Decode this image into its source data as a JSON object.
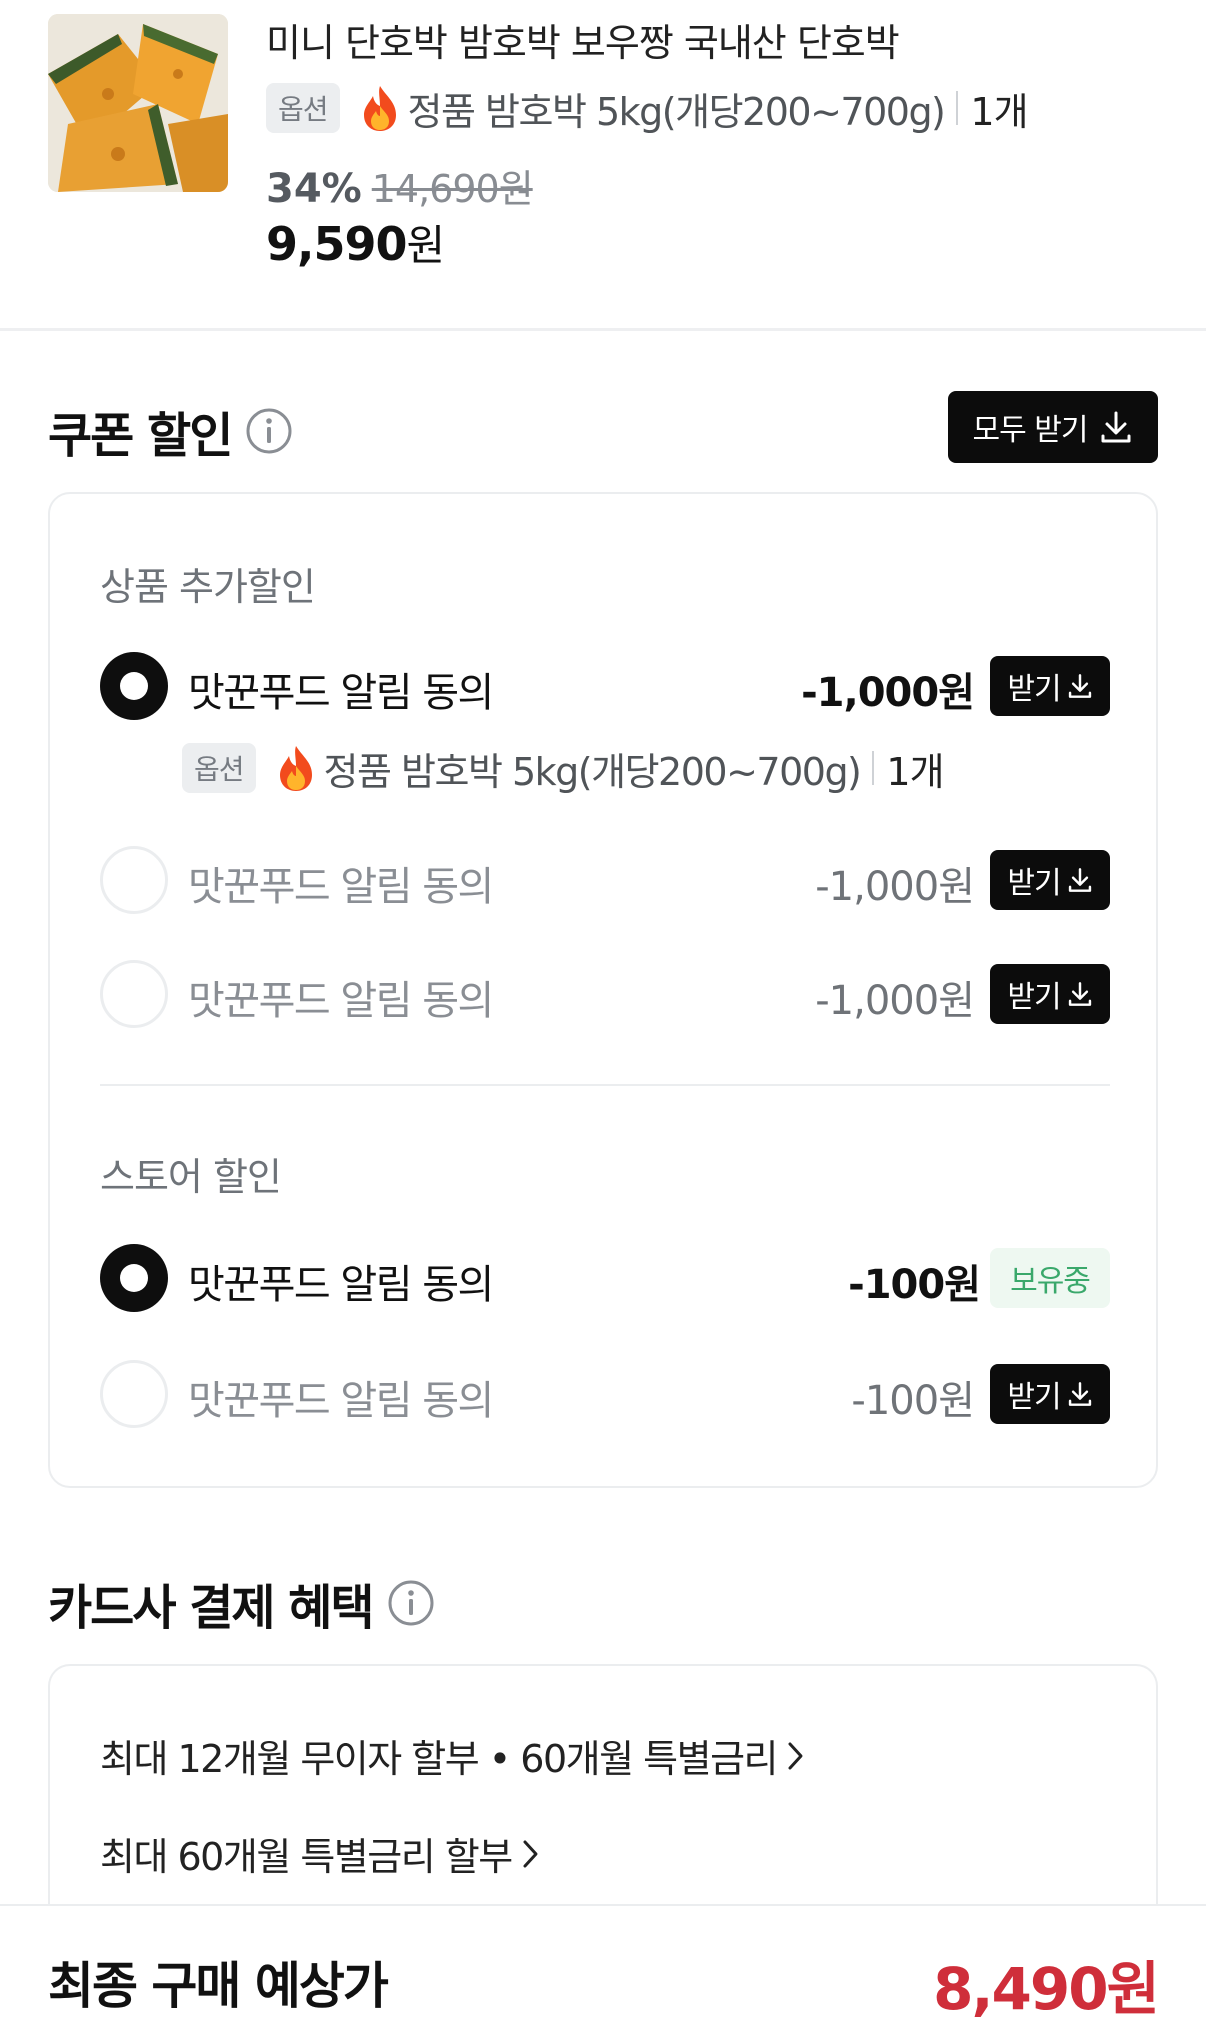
{
  "product": {
    "image_alt": "단호박",
    "title": "미니 단호박 밤호박 보우짱 국내산 단호박",
    "option_badge": "옵션",
    "option_text": "정품 밤호박 5kg(개당200~700g)",
    "quantity": "1개",
    "discount_rate": "34%",
    "original_price": "14,690원",
    "price": "9,590",
    "price_unit": "원"
  },
  "coupon_section": {
    "title": "쿠폰 할인",
    "receive_all_label": "모두 받기",
    "product_group": {
      "label": "상품 추가할인",
      "items": [
        {
          "label": "맛꾼푸드 알림 동의",
          "amount": "-1,000원",
          "button": "받기",
          "selected": true
        },
        {
          "label": "맛꾼푸드 알림 동의",
          "amount": "-1,000원",
          "button": "받기",
          "selected": false
        },
        {
          "label": "맛꾼푸드 알림 동의",
          "amount": "-1,000원",
          "button": "받기",
          "selected": false
        }
      ],
      "applied_option_badge": "옵션",
      "applied_option_text": "정품 밤호박 5kg(개당200~700g)",
      "applied_quantity": "1개"
    },
    "store_group": {
      "label": "스토어 할인",
      "items": [
        {
          "label": "맛꾼푸드 알림 동의",
          "amount": "-100원",
          "status": "보유중",
          "selected": true
        },
        {
          "label": "맛꾼푸드 알림 동의",
          "amount": "-100원",
          "button": "받기",
          "selected": false
        }
      ]
    }
  },
  "card_section": {
    "title": "카드사 결제 혜택",
    "benefits": [
      "최대 12개월 무이자 할부 • 60개월 특별금리",
      "최대 60개월 특별금리 할부"
    ]
  },
  "footer": {
    "final_label": "최종 구매 예상가",
    "final_price": "8,490원"
  },
  "colors": {
    "accent_red": "#cf2e3a",
    "button_black": "#0c0c0c",
    "owned_green": "#3aa86b"
  },
  "icons": [
    "fire-emoji-icon",
    "info-icon",
    "download-icon",
    "chevron-right-icon"
  ]
}
